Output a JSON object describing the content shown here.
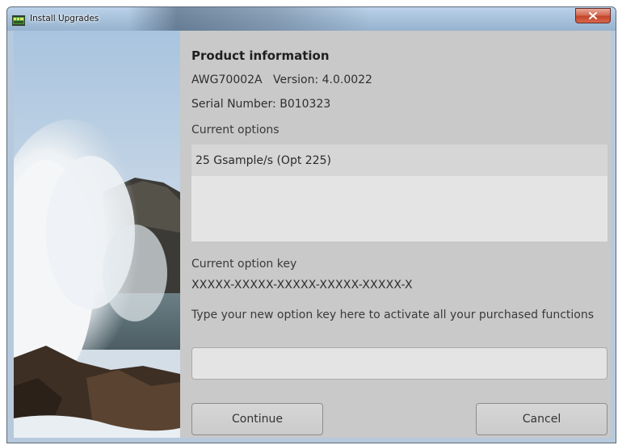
{
  "window": {
    "title": "Install Upgrades",
    "close_glyph": "×"
  },
  "product": {
    "heading": "Product information",
    "model_version": "AWG70002A   Version: 4.0.0022",
    "serial": "Serial Number: B010323"
  },
  "options": {
    "label": "Current options",
    "items": [
      "25 Gsample/s (Opt 225)"
    ]
  },
  "option_key": {
    "label": "Current option key",
    "value": "XXXXX-XXXXX-XXXXX-XXXXX-XXXXX-X"
  },
  "new_key": {
    "prompt": "Type your new option key here to activate all your purchased functions",
    "value": "",
    "placeholder": ""
  },
  "buttons": {
    "continue": "Continue",
    "cancel": "Cancel"
  },
  "icons": {
    "app": "app-window-icon",
    "close": "close-icon"
  },
  "colors": {
    "panel_bg": "#c9c9c9",
    "list_bg": "#e4e4e4",
    "selected_row": "#d6d6d6",
    "close_red": "#c2452b"
  }
}
